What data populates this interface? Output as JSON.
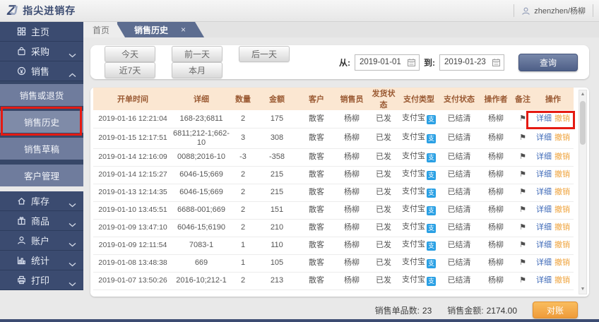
{
  "topbar": {
    "logo_z": "Z",
    "logo_j": "J",
    "app_title": "指尖进销存",
    "username": "zhenzhen/杨柳"
  },
  "sidebar": {
    "items": [
      {
        "id": "home",
        "label": "主页",
        "icon": "grid-icon",
        "type": "main",
        "chevron": ""
      },
      {
        "id": "purchase",
        "label": "采购",
        "icon": "bag-icon",
        "type": "main",
        "chevron": "down"
      },
      {
        "id": "sales",
        "label": "销售",
        "icon": "sales-icon",
        "type": "main",
        "chevron": "up"
      },
      {
        "id": "sales-or-return",
        "label": "销售或退货",
        "type": "sub",
        "active": false
      },
      {
        "id": "sales-history",
        "label": "销售历史",
        "type": "sub",
        "active": true
      },
      {
        "id": "sales-draft",
        "label": "销售草稿",
        "type": "sub",
        "active": false
      },
      {
        "id": "customer-mgmt",
        "label": "客户管理",
        "type": "sub",
        "active": false
      },
      {
        "id": "inventory",
        "label": "库存",
        "icon": "house-icon",
        "type": "main",
        "chevron": "down"
      },
      {
        "id": "goods",
        "label": "商品",
        "icon": "gift-icon",
        "type": "main",
        "chevron": "down"
      },
      {
        "id": "account",
        "label": "账户",
        "icon": "person-icon",
        "type": "main",
        "chevron": "down"
      },
      {
        "id": "stats",
        "label": "统计",
        "icon": "chart-icon",
        "type": "main",
        "chevron": "down"
      },
      {
        "id": "print",
        "label": "打印",
        "icon": "printer-icon",
        "type": "main",
        "chevron": "down"
      }
    ]
  },
  "tabs": [
    {
      "id": "tab-home",
      "label": "首页",
      "active": false,
      "closable": false
    },
    {
      "id": "tab-sales-history",
      "label": "销售历史",
      "active": true,
      "closable": true
    }
  ],
  "toolbar": {
    "quick_buttons": [
      "今天",
      "前一天",
      "后一天",
      "近7天",
      "本月"
    ],
    "from_label": "从:",
    "from_value": "2019-01-01",
    "to_label": "到:",
    "to_value": "2019-01-23",
    "query_label": "查询"
  },
  "table": {
    "headers": [
      "开单时间",
      "详细",
      "数量",
      "金额",
      "客户",
      "销售员",
      "发货状态",
      "支付类型",
      "支付状态",
      "操作者",
      "备注",
      "操作"
    ],
    "actions": {
      "detail": "详细",
      "revoke": "撤销"
    },
    "rows": [
      {
        "time": "2019-01-16 12:21:04",
        "detail": "168-23;6811",
        "qty": "2",
        "amount": "175",
        "customer": "散客",
        "salesperson": "杨柳",
        "ship_status": "已发",
        "pay_type": "支付宝",
        "pay_status": "已结清",
        "operator": "杨柳"
      },
      {
        "time": "2019-01-15 12:17:51",
        "detail": "6811;212-1;662-10",
        "qty": "3",
        "amount": "308",
        "customer": "散客",
        "salesperson": "杨柳",
        "ship_status": "已发",
        "pay_type": "支付宝",
        "pay_status": "已结清",
        "operator": "杨柳"
      },
      {
        "time": "2019-01-14 12:16:09",
        "detail": "0088;2016-10",
        "qty": "-3",
        "amount": "-358",
        "customer": "散客",
        "salesperson": "杨柳",
        "ship_status": "已发",
        "pay_type": "支付宝",
        "pay_status": "已结清",
        "operator": "杨柳"
      },
      {
        "time": "2019-01-14 12:15:27",
        "detail": "6046-15;669",
        "qty": "2",
        "amount": "215",
        "customer": "散客",
        "salesperson": "杨柳",
        "ship_status": "已发",
        "pay_type": "支付宝",
        "pay_status": "已结清",
        "operator": "杨柳"
      },
      {
        "time": "2019-01-13 12:14:35",
        "detail": "6046-15;669",
        "qty": "2",
        "amount": "215",
        "customer": "散客",
        "salesperson": "杨柳",
        "ship_status": "已发",
        "pay_type": "支付宝",
        "pay_status": "已结清",
        "operator": "杨柳"
      },
      {
        "time": "2019-01-10 13:45:51",
        "detail": "6688-001;669",
        "qty": "2",
        "amount": "151",
        "customer": "散客",
        "salesperson": "杨柳",
        "ship_status": "已发",
        "pay_type": "支付宝",
        "pay_status": "已结清",
        "operator": "杨柳"
      },
      {
        "time": "2019-01-09 13:47:10",
        "detail": "6046-15;6190",
        "qty": "2",
        "amount": "210",
        "customer": "散客",
        "salesperson": "杨柳",
        "ship_status": "已发",
        "pay_type": "支付宝",
        "pay_status": "已结清",
        "operator": "杨柳"
      },
      {
        "time": "2019-01-09 12:11:54",
        "detail": "7083-1",
        "qty": "1",
        "amount": "110",
        "customer": "散客",
        "salesperson": "杨柳",
        "ship_status": "已发",
        "pay_type": "支付宝",
        "pay_status": "已结清",
        "operator": "杨柳"
      },
      {
        "time": "2019-01-08 13:48:38",
        "detail": "669",
        "qty": "1",
        "amount": "105",
        "customer": "散客",
        "salesperson": "杨柳",
        "ship_status": "已发",
        "pay_type": "支付宝",
        "pay_status": "已结清",
        "operator": "杨柳"
      },
      {
        "time": "2019-01-07 13:50:26",
        "detail": "2016-10;212-1",
        "qty": "2",
        "amount": "213",
        "customer": "散客",
        "salesperson": "杨柳",
        "ship_status": "已发",
        "pay_type": "支付宝",
        "pay_status": "已结清",
        "operator": "杨柳"
      }
    ]
  },
  "footer": {
    "count_label": "销售单品数:",
    "count_value": "23",
    "amount_label": "销售金额:",
    "amount_value": "2174.00",
    "reconcile_label": "对账"
  },
  "glyphs": {
    "alipay": "支",
    "flag": "⚑",
    "scroll_up": "▲",
    "scroll_down": "▼",
    "close_tab": "×"
  }
}
